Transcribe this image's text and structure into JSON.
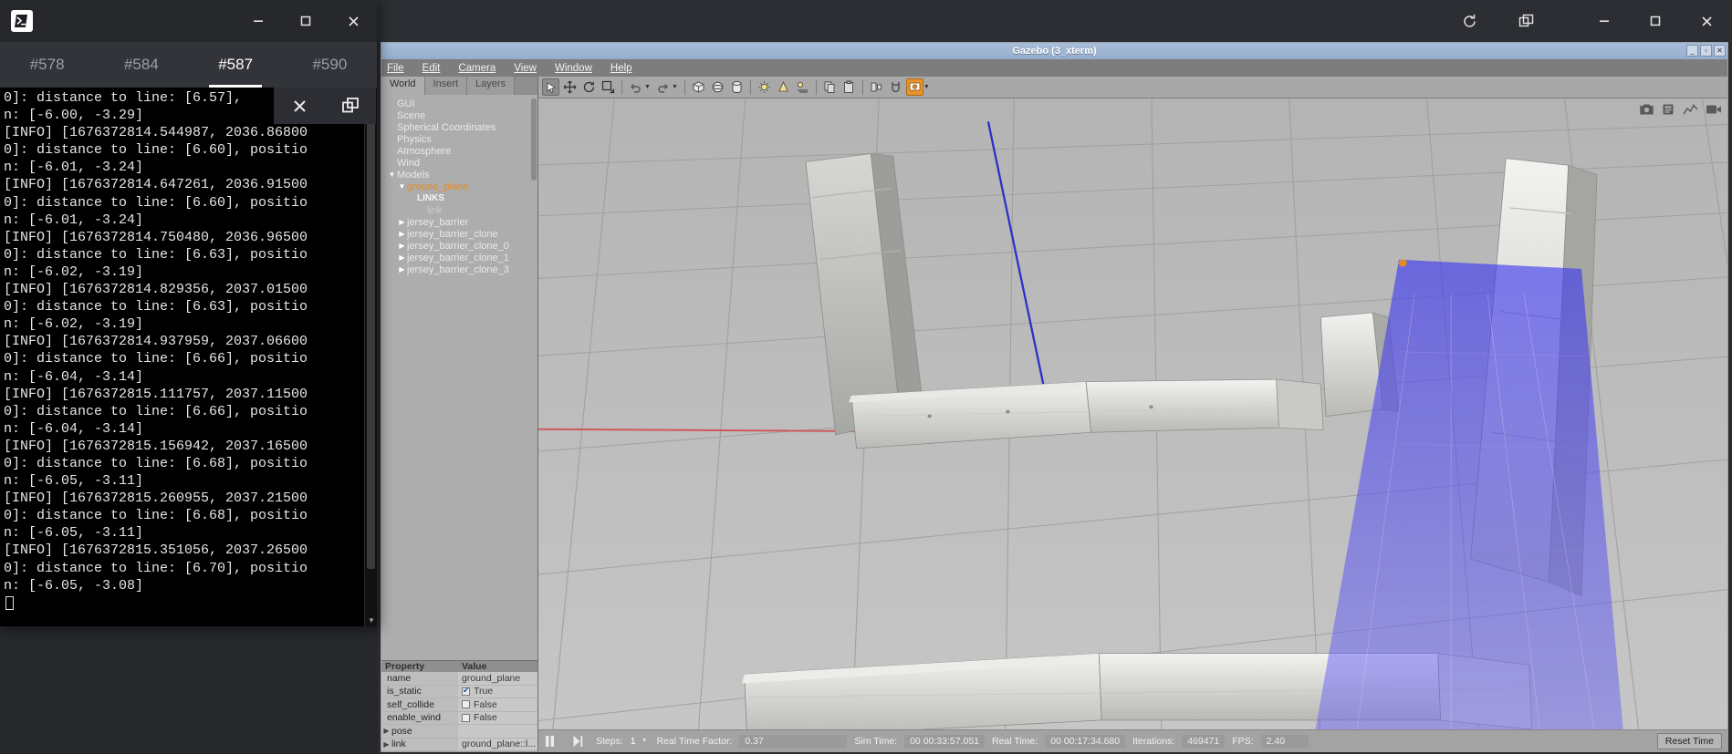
{
  "terminal": {
    "window_title": "terminal",
    "logo_icon": "terminal-prompt-icon",
    "tabs": [
      {
        "label": "#578",
        "active": false
      },
      {
        "label": "#584",
        "active": false
      },
      {
        "label": "#587",
        "active": true
      },
      {
        "label": "#590",
        "active": false
      }
    ],
    "window_buttons": {
      "minimize": "minimize-icon",
      "maximize": "maximize-icon",
      "close": "close-icon"
    },
    "float_buttons": {
      "close": "close-icon",
      "restore": "restore-icon"
    },
    "output": "0]: distance to line: [6.57],\nn: [-6.00, -3.29]\n[INFO] [1676372814.544987, 2036.86800\n0]: distance to line: [6.60], positio\nn: [-6.01, -3.24]\n[INFO] [1676372814.647261, 2036.91500\n0]: distance to line: [6.60], positio\nn: [-6.01, -3.24]\n[INFO] [1676372814.750480, 2036.96500\n0]: distance to line: [6.63], positio\nn: [-6.02, -3.19]\n[INFO] [1676372814.829356, 2037.01500\n0]: distance to line: [6.63], positio\nn: [-6.02, -3.19]\n[INFO] [1676372814.937959, 2037.06600\n0]: distance to line: [6.66], positio\nn: [-6.04, -3.14]\n[INFO] [1676372815.111757, 2037.11500\n0]: distance to line: [6.66], positio\nn: [-6.04, -3.14]\n[INFO] [1676372815.156942, 2037.16500\n0]: distance to line: [6.68], positio\nn: [-6.05, -3.11]\n[INFO] [1676372815.260955, 2037.21500\n0]: distance to line: [6.68], positio\nn: [-6.05, -3.11]\n[INFO] [1676372815.351056, 2037.26500\n0]: distance to line: [6.70], positio\nn: [-6.05, -3.08]"
  },
  "gazebo": {
    "outer_window_buttons": {
      "reload": "reload-icon",
      "duplicate": "duplicate-icon",
      "minimize": "minimize-icon",
      "maximize": "maximize-icon",
      "close": "close-icon"
    },
    "title": "Gazebo (3_xterm)",
    "title_buttons": {
      "minimize": "_",
      "maximize": "▫",
      "close": "✕"
    },
    "menu": [
      {
        "label": "File",
        "accel": "F"
      },
      {
        "label": "Edit",
        "accel": "E"
      },
      {
        "label": "Camera",
        "accel": "C"
      },
      {
        "label": "View",
        "accel": "V"
      },
      {
        "label": "Window",
        "accel": "W"
      },
      {
        "label": "Help",
        "accel": "H"
      }
    ],
    "tabs": [
      {
        "label": "World",
        "active": true
      },
      {
        "label": "Insert",
        "active": false
      },
      {
        "label": "Layers",
        "active": false
      }
    ],
    "tree": [
      {
        "label": "GUI",
        "indent": 1,
        "arrow": "",
        "style": ""
      },
      {
        "label": "Scene",
        "indent": 1,
        "arrow": "",
        "style": ""
      },
      {
        "label": "Spherical Coordinates",
        "indent": 1,
        "arrow": "",
        "style": ""
      },
      {
        "label": "Physics",
        "indent": 1,
        "arrow": "",
        "style": ""
      },
      {
        "label": "Atmosphere",
        "indent": 1,
        "arrow": "",
        "style": ""
      },
      {
        "label": "Wind",
        "indent": 1,
        "arrow": "",
        "style": ""
      },
      {
        "label": "Models",
        "indent": 1,
        "arrow": "▼",
        "style": ""
      },
      {
        "label": "ground_plane",
        "indent": 2,
        "arrow": "▼",
        "style": "sel"
      },
      {
        "label": "LINKS",
        "indent": 3,
        "arrow": "",
        "style": "links"
      },
      {
        "label": "link",
        "indent": 4,
        "arrow": "",
        "style": "linkitem"
      },
      {
        "label": "jersey_barrier",
        "indent": 2,
        "arrow": "▶",
        "style": ""
      },
      {
        "label": "jersey_barrier_clone",
        "indent": 2,
        "arrow": "▶",
        "style": ""
      },
      {
        "label": "jersey_barrier_clone_0",
        "indent": 2,
        "arrow": "▶",
        "style": ""
      },
      {
        "label": "jersey_barrier_clone_1",
        "indent": 2,
        "arrow": "▶",
        "style": ""
      },
      {
        "label": "jersey_barrier_clone_3",
        "indent": 2,
        "arrow": "▶",
        "style": ""
      }
    ],
    "property_header": {
      "name": "Property",
      "value": "Value"
    },
    "properties": [
      {
        "key": "name",
        "value": "ground_plane",
        "type": "text",
        "expandable": false
      },
      {
        "key": "is_static",
        "value": "True",
        "type": "checkbox",
        "checked": true,
        "expandable": false
      },
      {
        "key": "self_collide",
        "value": "False",
        "type": "checkbox",
        "checked": false,
        "expandable": false
      },
      {
        "key": "enable_wind",
        "value": "False",
        "type": "checkbox",
        "checked": false,
        "expandable": false
      },
      {
        "key": "pose",
        "value": "",
        "type": "text",
        "expandable": true
      },
      {
        "key": "link",
        "value": "ground_plane::l...",
        "type": "text",
        "expandable": true
      }
    ],
    "toolbar": [
      {
        "icon": "select-arrow-icon",
        "active": true
      },
      {
        "icon": "translate-move-icon",
        "active": false
      },
      {
        "icon": "rotate-icon",
        "active": false
      },
      {
        "icon": "scale-icon",
        "active": false
      },
      {
        "icon": "undo-icon",
        "active": false
      },
      {
        "icon": "redo-icon",
        "active": false
      },
      {
        "icon": "box-icon",
        "active": false
      },
      {
        "icon": "sphere-icon",
        "active": false
      },
      {
        "icon": "cylinder-icon",
        "active": false
      },
      {
        "icon": "point-light-icon",
        "active": false
      },
      {
        "icon": "spot-light-icon",
        "active": false
      },
      {
        "icon": "directional-light-icon",
        "active": false
      },
      {
        "icon": "copy-icon",
        "active": false
      },
      {
        "icon": "paste-icon",
        "active": false
      },
      {
        "icon": "align-icon",
        "active": false
      },
      {
        "icon": "snap-icon",
        "active": false
      },
      {
        "icon": "change-view-icon",
        "active": true
      }
    ],
    "viewport_buttons": [
      {
        "icon": "screenshot-camera-icon"
      },
      {
        "icon": "log-record-icon"
      },
      {
        "icon": "plot-icon"
      },
      {
        "icon": "video-record-icon"
      }
    ],
    "statusbar": {
      "play_pause_icon": "pause-icon",
      "step_icon": "step-forward-icon",
      "steps_label": "Steps:",
      "steps_value": "1",
      "real_time_factor_label": "Real Time Factor:",
      "real_time_factor_value": "0.37",
      "sim_time_label": "Sim Time:",
      "sim_time_value": "00 00:33:57.051",
      "real_time_label": "Real Time:",
      "real_time_value": "00 00:17:34.680",
      "iterations_label": "Iterations:",
      "iterations_value": "469471",
      "fps_label": "FPS:",
      "fps_value": "2.40",
      "reset_time_label": "Reset Time"
    },
    "colors": {
      "selection_orange": "#e08c28",
      "laser_blue": "#4a46ea",
      "titlebar_blue": "#a8bdd9",
      "panel_grey": "#adadad"
    }
  }
}
